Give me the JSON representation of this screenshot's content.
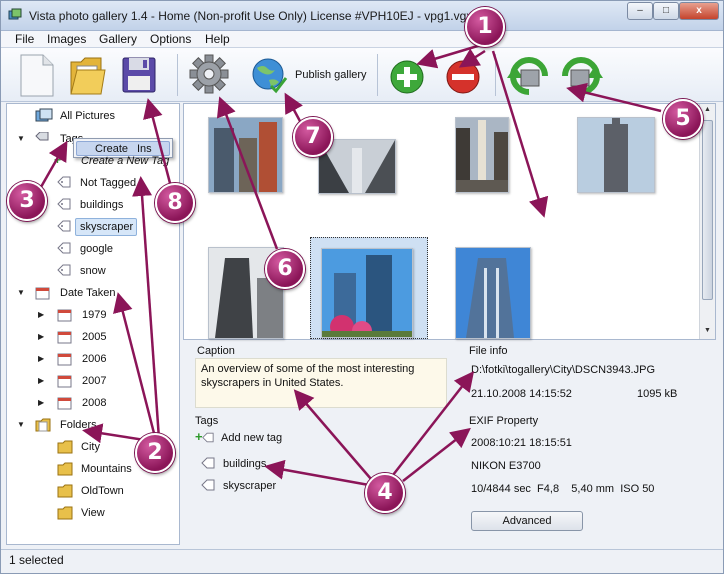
{
  "window": {
    "title": "Vista photo gallery 1.4 - Home (Non-profit Use Only) License #VPH10EJ - vpg1.vgx",
    "minimize": "–",
    "maximize": "□",
    "close": "x"
  },
  "menu": [
    "File",
    "Images",
    "Gallery",
    "Options",
    "Help"
  ],
  "toolbar": {
    "publish_label": "Publish gallery"
  },
  "tree": {
    "all_pictures": "All Pictures",
    "tags_label": "Tags",
    "context_menu": {
      "label": "Create",
      "shortcut": "Ins"
    },
    "create_tag": "Create a New Tag",
    "tags": [
      "Not Tagged",
      "buildings",
      "skyscraper",
      "google",
      "snow"
    ],
    "date_taken": "Date Taken",
    "years": [
      "1979",
      "2005",
      "2006",
      "2007",
      "2008"
    ],
    "folders_label": "Folders",
    "folders": [
      "City",
      "Mountains",
      "OldTown",
      "View"
    ]
  },
  "caption": {
    "title": "Caption",
    "text": "An overview of some of the most interesting skyscrapers in United States."
  },
  "file_info": {
    "title": "File info",
    "path": "D:\\fotki\\togallery\\City\\DSCN3943.JPG",
    "datetime": "21.10.2008 14:15:52",
    "size": "1095 kB"
  },
  "tags_panel": {
    "title": "Tags",
    "add_label": "Add new tag",
    "items": [
      "buildings",
      "skyscraper"
    ]
  },
  "exif": {
    "title": "EXIF Property",
    "datetime": "2008:10:21 18:15:51",
    "camera": "NIKON E3700",
    "exposure": "10/4844 sec  F4,8    5,40 mm  ISO 50",
    "advanced_label": "Advanced"
  },
  "status": {
    "text": "1 selected"
  },
  "callouts": [
    "1",
    "2",
    "3",
    "4",
    "5",
    "6",
    "7",
    "8"
  ]
}
